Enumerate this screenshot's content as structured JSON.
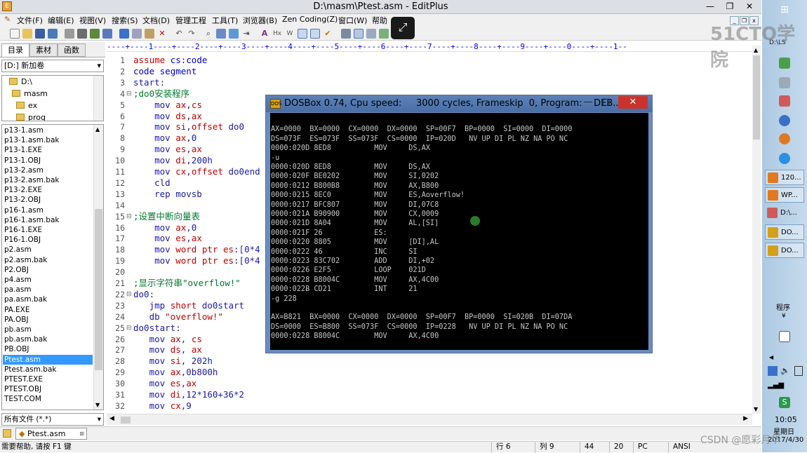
{
  "window": {
    "title": "D:\\masm\\Ptest.asm - EditPlus"
  },
  "menu": [
    "文件(F)",
    "编辑(E)",
    "视图(V)",
    "搜索(S)",
    "文档(D)",
    "管理工程",
    "工具(T)",
    "浏览器(B)",
    "Zen Coding(Z)",
    "窗口(W)",
    "帮助"
  ],
  "left_panel": {
    "tabs": [
      "目录",
      "素材",
      "函数"
    ],
    "drive": "[D:] 新加卷",
    "tree": [
      "D:\\",
      "masm",
      "ex",
      "prog"
    ],
    "files": [
      "p13-1.asm",
      "p13-1.asm.bak",
      "P13-1.EXE",
      "P13-1.OBJ",
      "p13-2.asm",
      "p13-2.asm.bak",
      "P13-2.EXE",
      "P13-2.OBJ",
      "p16-1.asm",
      "p16-1.asm.bak",
      "P16-1.EXE",
      "P16-1.OBJ",
      "p2.asm",
      "p2.asm.bak",
      "P2.OBJ",
      "p4.asm",
      "pa.asm",
      "pa.asm.bak",
      "PA.EXE",
      "PA.OBJ",
      "pb.asm",
      "pb.asm.bak",
      "PB.OBJ",
      "Ptest.asm",
      "Ptest.asm.bak",
      "PTEST.EXE",
      "PTEST.OBJ",
      "TEST.COM"
    ],
    "selected_file": "Ptest.asm",
    "filter": "所有文件 (*.*)"
  },
  "ruler": "----+----1----+----2----+----3----+----4----+----5----+----6----+----7----+----8----+----9----+----0----+----1--",
  "code_lines": [
    {
      "n": "1",
      "parts": [
        {
          "t": "assume ",
          "c": "c-red"
        },
        {
          "t": "cs",
          "c": "c-blue"
        },
        {
          "t": ":code",
          "c": "c-blue"
        }
      ]
    },
    {
      "n": "2",
      "parts": [
        {
          "t": "code ",
          "c": "c-blue"
        },
        {
          "t": "segment",
          "c": "c-blue"
        }
      ]
    },
    {
      "n": "3",
      "parts": [
        {
          "t": "start:",
          "c": "c-navy"
        }
      ]
    },
    {
      "n": "4",
      "fold": "⊟",
      "parts": [
        {
          "t": ";do0安装程序",
          "c": "c-green"
        }
      ]
    },
    {
      "n": "5",
      "parts": [
        {
          "t": "    mov ",
          "c": "c-navy"
        },
        {
          "t": "ax",
          "c": "c-red"
        },
        {
          "t": ",",
          "c": "c-navy"
        },
        {
          "t": "cs",
          "c": "c-red"
        }
      ]
    },
    {
      "n": "6",
      "parts": [
        {
          "t": "    mov ",
          "c": "c-navy"
        },
        {
          "t": "ds",
          "c": "c-red"
        },
        {
          "t": ",",
          "c": "c-navy"
        },
        {
          "t": "ax",
          "c": "c-red"
        }
      ]
    },
    {
      "n": "7",
      "parts": [
        {
          "t": "    mov ",
          "c": "c-navy"
        },
        {
          "t": "si",
          "c": "c-red"
        },
        {
          "t": ",",
          "c": "c-navy"
        },
        {
          "t": "offset",
          "c": "c-red"
        },
        {
          "t": " do0",
          "c": "c-navy"
        }
      ]
    },
    {
      "n": "8",
      "parts": [
        {
          "t": "    mov ",
          "c": "c-navy"
        },
        {
          "t": "ax",
          "c": "c-red"
        },
        {
          "t": ",0",
          "c": "c-navy"
        }
      ]
    },
    {
      "n": "9",
      "parts": [
        {
          "t": "    mov ",
          "c": "c-navy"
        },
        {
          "t": "es",
          "c": "c-red"
        },
        {
          "t": ",",
          "c": "c-navy"
        },
        {
          "t": "ax",
          "c": "c-red"
        }
      ]
    },
    {
      "n": "10",
      "parts": [
        {
          "t": "    mov ",
          "c": "c-navy"
        },
        {
          "t": "di",
          "c": "c-red"
        },
        {
          "t": ",200h",
          "c": "c-navy"
        }
      ]
    },
    {
      "n": "11",
      "parts": [
        {
          "t": "    mov ",
          "c": "c-navy"
        },
        {
          "t": "cx",
          "c": "c-red"
        },
        {
          "t": ",",
          "c": "c-navy"
        },
        {
          "t": "offset",
          "c": "c-red"
        },
        {
          "t": " do0end",
          "c": "c-navy"
        }
      ]
    },
    {
      "n": "12",
      "parts": [
        {
          "t": "    cld",
          "c": "c-navy"
        }
      ]
    },
    {
      "n": "13",
      "parts": [
        {
          "t": "    rep movsb",
          "c": "c-navy"
        }
      ]
    },
    {
      "n": "14",
      "parts": []
    },
    {
      "n": "15",
      "fold": "⊟",
      "parts": [
        {
          "t": ";设置中断向量表",
          "c": "c-green"
        }
      ]
    },
    {
      "n": "16",
      "parts": [
        {
          "t": "    mov ",
          "c": "c-navy"
        },
        {
          "t": "ax",
          "c": "c-red"
        },
        {
          "t": ",0",
          "c": "c-navy"
        }
      ]
    },
    {
      "n": "17",
      "parts": [
        {
          "t": "    mov ",
          "c": "c-navy"
        },
        {
          "t": "es",
          "c": "c-red"
        },
        {
          "t": ",",
          "c": "c-navy"
        },
        {
          "t": "ax",
          "c": "c-red"
        }
      ]
    },
    {
      "n": "18",
      "parts": [
        {
          "t": "    mov ",
          "c": "c-navy"
        },
        {
          "t": "word ptr ",
          "c": "c-red"
        },
        {
          "t": "es",
          "c": "c-red"
        },
        {
          "t": ":[0*4",
          "c": "c-navy"
        }
      ]
    },
    {
      "n": "19",
      "parts": [
        {
          "t": "    mov ",
          "c": "c-navy"
        },
        {
          "t": "word ptr ",
          "c": "c-red"
        },
        {
          "t": "es",
          "c": "c-red"
        },
        {
          "t": ":[0*4",
          "c": "c-navy"
        }
      ]
    },
    {
      "n": "20",
      "parts": []
    },
    {
      "n": "21",
      "parts": [
        {
          "t": ";显示字符串\"overflow!\"",
          "c": "c-green"
        }
      ]
    },
    {
      "n": "22",
      "fold": "⊟",
      "parts": [
        {
          "t": "do0:",
          "c": "c-navy"
        }
      ]
    },
    {
      "n": "23",
      "parts": [
        {
          "t": "   jmp ",
          "c": "c-navy"
        },
        {
          "t": "short",
          "c": "c-red"
        },
        {
          "t": " do0start",
          "c": "c-navy"
        }
      ]
    },
    {
      "n": "24",
      "parts": [
        {
          "t": "   db ",
          "c": "c-navy"
        },
        {
          "t": "\"overflow!\"",
          "c": "c-red"
        }
      ]
    },
    {
      "n": "25",
      "fold": "⊟",
      "parts": [
        {
          "t": "do0start:",
          "c": "c-navy"
        }
      ]
    },
    {
      "n": "26",
      "parts": [
        {
          "t": "   mov ",
          "c": "c-navy"
        },
        {
          "t": "ax",
          "c": "c-red"
        },
        {
          "t": ", ",
          "c": "c-navy"
        },
        {
          "t": "cs",
          "c": "c-red"
        }
      ]
    },
    {
      "n": "27",
      "parts": [
        {
          "t": "   mov ",
          "c": "c-navy"
        },
        {
          "t": "ds",
          "c": "c-red"
        },
        {
          "t": ", ",
          "c": "c-navy"
        },
        {
          "t": "ax",
          "c": "c-red"
        }
      ]
    },
    {
      "n": "28",
      "parts": [
        {
          "t": "   mov ",
          "c": "c-navy"
        },
        {
          "t": "si",
          "c": "c-red"
        },
        {
          "t": ", 202h",
          "c": "c-navy"
        }
      ]
    },
    {
      "n": "29",
      "parts": [
        {
          "t": "   mov ",
          "c": "c-navy"
        },
        {
          "t": "ax",
          "c": "c-red"
        },
        {
          "t": ",0b800h",
          "c": "c-navy"
        }
      ]
    },
    {
      "n": "30",
      "parts": [
        {
          "t": "   mov ",
          "c": "c-navy"
        },
        {
          "t": "es",
          "c": "c-red"
        },
        {
          "t": ",",
          "c": "c-navy"
        },
        {
          "t": "ax",
          "c": "c-red"
        }
      ]
    },
    {
      "n": "31",
      "parts": [
        {
          "t": "   mov ",
          "c": "c-navy"
        },
        {
          "t": "di",
          "c": "c-red"
        },
        {
          "t": ",12*160+36*2",
          "c": "c-navy"
        }
      ]
    },
    {
      "n": "32",
      "parts": [
        {
          "t": "   mov ",
          "c": "c-navy"
        },
        {
          "t": "cx",
          "c": "c-red"
        },
        {
          "t": ",9",
          "c": "c-navy"
        }
      ]
    }
  ],
  "doc_tab": "Ptest.asm",
  "status": {
    "help": "需要帮助, 请按 F1 键",
    "row": "行 6",
    "col": "列 9",
    "v44": "44",
    "v20": "20",
    "mode": "PC",
    "enc": "ANSI"
  },
  "dosbox": {
    "title": "DOSBox 0.74, Cpu speed:     3000 cycles, Frameskip  0, Program:    DEB...",
    "lines": [
      "",
      "AX=0000  BX=0000  CX=0000  DX=0000  SP=00F7  BP=0000  SI=0000  DI=0000",
      "DS=073F  ES=073F  SS=073F  CS=0000  IP=020D   NV UP DI PL NZ NA PO NC",
      "0000:020D 8ED8          MOV     DS,AX",
      "-u",
      "0000:020D 8ED8          MOV     DS,AX",
      "0000:020F BE0202        MOV     SI,0202",
      "0000:0212 B800B8        MOV     AX,B800",
      "0000:0215 8EC0          MOV     ES,Aoverflow!",
      "0000:0217 BFC807        MOV     DI,07C8",
      "0000:021A B90900        MOV     CX,0009",
      "0000:021D 8A04          MOV     AL,[SI]",
      "0000:021F 26            ES:",
      "0000:0220 8805          MOV     [DI],AL",
      "0000:0222 46            INC     SI",
      "0000:0223 83C702        ADD     DI,+02",
      "0000:0226 E2F5          LOOP    021D",
      "0000:0228 B8004C        MOV     AX,4C00",
      "0000:022B CD21          INT     21",
      "-g 228",
      "",
      "AX=B821  BX=0000  CX=0000  DX=0000  SP=00F7  BP=0000  SI=020B  DI=07DA",
      "DS=0000  ES=B800  SS=073F  CS=0000  IP=0228   NV UP DI PL NZ NA PO NC",
      "0000:0228 B8004C        MOV     AX,4C00",
      "",
      "-_"
    ]
  },
  "taskbar": {
    "items": [
      "120...",
      "WP...",
      "D:\\...",
      "DO...",
      "DO..."
    ],
    "top_label": "D:\\LS",
    "program_label": "程序",
    "clock": "10:05",
    "day": "星期日",
    "year": "2017/4/30"
  },
  "watermark": "51CTO学院",
  "credit": "CSDN @愿彩月华"
}
